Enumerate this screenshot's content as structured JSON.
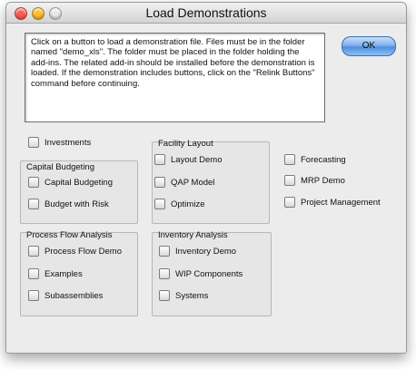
{
  "window": {
    "title": "Load Demonstrations",
    "controls": {
      "close_color": "#ff5a52",
      "minimize_color": "#ffbd2e",
      "zoom_color": "#e8e8e8"
    }
  },
  "instructions": "Click on a button to load a demonstration file.  Files must be in the folder named \"demo_xls\".  The folder must be placed in the folder holding the add-ins.  The related add-in should be installed before the demonstration is loaded.  If the demonstration includes buttons, click on the \"Relink Buttons\" command before continuing.",
  "ok_label": "OK",
  "standalone": {
    "investments": "Investments"
  },
  "capital_budgeting": {
    "title": "Capital Budgeting",
    "items": [
      "Capital Budgeting",
      "Budget with Risk"
    ]
  },
  "facility_layout": {
    "title": "Facility Layout",
    "items": [
      "Layout Demo",
      "QAP Model",
      "Optimize"
    ]
  },
  "right_column": {
    "items": [
      "Forecasting",
      "MRP Demo",
      "Project Management"
    ]
  },
  "process_flow": {
    "title": "Process Flow Analysis",
    "items": [
      "Process Flow Demo",
      "Examples",
      "Subassemblies"
    ]
  },
  "inventory": {
    "title": "Inventory Analysis",
    "items": [
      "Inventory Demo",
      "WIP Components",
      "Systems"
    ]
  }
}
